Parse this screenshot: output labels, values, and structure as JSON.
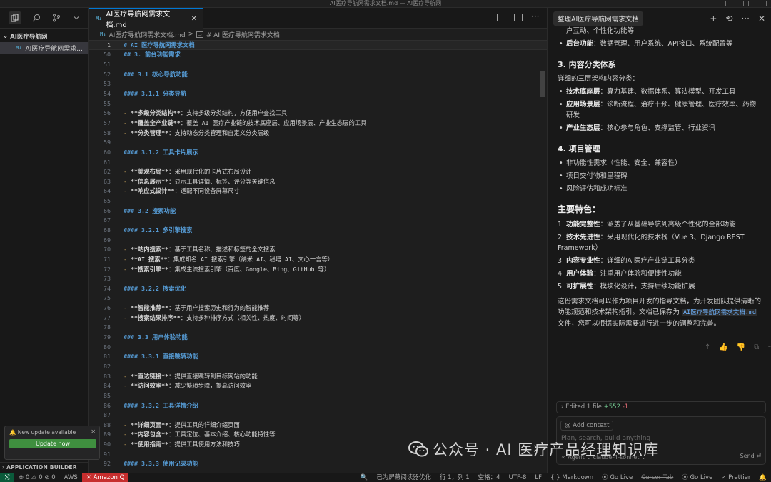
{
  "window": {
    "title": "AI医疗导航网需求文档.md — AI医疗导航网"
  },
  "sidebar": {
    "folder": "AI医疗导航网",
    "file": "AI医疗导航网需求...",
    "section": "APPLICATION BUILDER",
    "update": {
      "title": "New update available",
      "button": "Update now"
    }
  },
  "editor": {
    "tab": {
      "badge": "M↓",
      "label": "AI医疗导航网需求文档.md"
    },
    "breadcrumb": {
      "file": "AI医疗导航网需求文档.md",
      "sep": ">",
      "badge": "M↓",
      "heading": "# AI 医疗导航网需求文档"
    },
    "lines": [
      {
        "n": "1",
        "t": "h",
        "text": "# AI 医疗导航网需求文档",
        "current": true
      },
      {
        "n": "50",
        "t": "h",
        "text": "## 3. 前台功能需求"
      },
      {
        "n": "51",
        "t": "blank",
        "text": ""
      },
      {
        "n": "52",
        "t": "h",
        "text": "### 3.1 核心导航功能"
      },
      {
        "n": "53",
        "t": "blank",
        "text": ""
      },
      {
        "n": "54",
        "t": "h",
        "text": "#### 3.1.1 分类导航"
      },
      {
        "n": "55",
        "t": "blank",
        "text": ""
      },
      {
        "n": "56",
        "t": "li",
        "b": "**多级分类结构**",
        "text": "：支持多级分类结构，方便用户查找工具"
      },
      {
        "n": "57",
        "t": "li",
        "b": "**覆盖全产业链**",
        "text": "：覆盖 AI 医疗产业链的技术底座层、应用场景层、产业生态层的工具"
      },
      {
        "n": "58",
        "t": "li",
        "b": "**分类管理**",
        "text": "：支持动态分类管理和自定义分类层级"
      },
      {
        "n": "59",
        "t": "blank",
        "text": ""
      },
      {
        "n": "60",
        "t": "h",
        "text": "#### 3.1.2 工具卡片展示"
      },
      {
        "n": "61",
        "t": "blank",
        "text": ""
      },
      {
        "n": "62",
        "t": "li",
        "b": "**美观布局**",
        "text": "：采用现代化的卡片式布局设计"
      },
      {
        "n": "63",
        "t": "li",
        "b": "**信息展示**",
        "text": "：显示工具详情、标签、评分等关键信息"
      },
      {
        "n": "64",
        "t": "li",
        "b": "**响应式设计**",
        "text": "：适配不同设备屏幕尺寸"
      },
      {
        "n": "65",
        "t": "blank",
        "text": ""
      },
      {
        "n": "66",
        "t": "h",
        "text": "### 3.2 搜索功能"
      },
      {
        "n": "67",
        "t": "blank",
        "text": ""
      },
      {
        "n": "68",
        "t": "h",
        "text": "#### 3.2.1 多引擎搜索"
      },
      {
        "n": "69",
        "t": "blank",
        "text": ""
      },
      {
        "n": "70",
        "t": "li",
        "b": "**站内搜索**",
        "text": "：基于工具名称、描述和标签的全文搜索"
      },
      {
        "n": "71",
        "t": "li",
        "b": "**AI 搜索**",
        "text": "：集成知名 AI 搜索引擎（纳米 AI、秘塔 AI、文心一言等）"
      },
      {
        "n": "72",
        "t": "li",
        "b": "**搜索引擎**",
        "text": "：集成主流搜索引擎（百度、Google、Bing、GitHub 等）"
      },
      {
        "n": "73",
        "t": "blank",
        "text": ""
      },
      {
        "n": "74",
        "t": "h",
        "text": "#### 3.2.2 搜索优化"
      },
      {
        "n": "75",
        "t": "blank",
        "text": ""
      },
      {
        "n": "76",
        "t": "li",
        "b": "**智能推荐**",
        "text": "：基于用户搜索历史和行为的智能推荐"
      },
      {
        "n": "77",
        "t": "li",
        "b": "**搜索结果排序**",
        "text": "：支持多种排序方式（相关性、热度、时间等）"
      },
      {
        "n": "78",
        "t": "blank",
        "text": ""
      },
      {
        "n": "79",
        "t": "h",
        "text": "### 3.3 用户体验功能"
      },
      {
        "n": "80",
        "t": "blank",
        "text": ""
      },
      {
        "n": "81",
        "t": "h",
        "text": "#### 3.3.1 直接跳转功能"
      },
      {
        "n": "82",
        "t": "blank",
        "text": ""
      },
      {
        "n": "83",
        "t": "li",
        "b": "**直达链接**",
        "text": "：提供直接跳转到目标网站的功能"
      },
      {
        "n": "84",
        "t": "li",
        "b": "**访问效率**",
        "text": "：减少繁琐步骤，提高访问效率"
      },
      {
        "n": "85",
        "t": "blank",
        "text": ""
      },
      {
        "n": "86",
        "t": "h",
        "text": "#### 3.3.2 工具详情介绍"
      },
      {
        "n": "87",
        "t": "blank",
        "text": ""
      },
      {
        "n": "88",
        "t": "li",
        "b": "**详细页面**",
        "text": "：提供工具的详细介绍页面"
      },
      {
        "n": "89",
        "t": "li",
        "b": "**内容包含**",
        "text": "：工具定位、基本介绍、核心功能特性等"
      },
      {
        "n": "90",
        "t": "li",
        "b": "**使用指南**",
        "text": "：提供工具使用方法和技巧"
      },
      {
        "n": "91",
        "t": "blank",
        "text": ""
      },
      {
        "n": "92",
        "t": "h",
        "text": "#### 3.3.3 使用记录功能"
      }
    ]
  },
  "chat": {
    "tab": "整理AI医疗导航网需求文档",
    "frag": "户互动、个性化功能等",
    "backend": {
      "b": "后台功能",
      "text": "：数据管理、用户系统、API接口、系统配置等"
    },
    "sec3": "3. 内容分类体系",
    "sec3_intro": "详细的三层架构内容分类：",
    "sec3_items": [
      {
        "b": "技术底座层",
        "text": "：算力基建、数据体系、算法模型、开发工具"
      },
      {
        "b": "应用场景层",
        "text": "：诊断流程、治疗干预、健康管理、医疗效率、药物研发"
      },
      {
        "b": "产业生态层",
        "text": "：核心参与角色、支撑监管、行业资讯"
      }
    ],
    "sec4": "4. 项目管理",
    "sec4_items": [
      "非功能性需求（性能、安全、兼容性）",
      "项目交付物和里程碑",
      "风险评估和成功标准"
    ],
    "features_title": "主要特色：",
    "features": [
      {
        "n": "1.",
        "b": "功能完整性",
        "text": "：涵盖了从基础导航到高级个性化的全部功能"
      },
      {
        "n": "2.",
        "b": "技术先进性",
        "text": "：采用现代化的技术栈（Vue 3、Django REST Framework）"
      },
      {
        "n": "3.",
        "b": "内容专业性",
        "text": "：详细的AI医疗产业链工具分类"
      },
      {
        "n": "4.",
        "b": "用户体验",
        "text": "：注重用户体验和便捷性功能"
      },
      {
        "n": "5.",
        "b": "可扩展性",
        "text": "：模块化设计，支持后续功能扩展"
      }
    ],
    "summary_a": "这份需求文档可以作为项目开发的指导文档，为开发团队提供清晰的功能规范和技术架构指引。文档已保存为",
    "summary_code": "AI医疗导航网需求文档.md",
    "summary_b": "文件，您可以根据实际需要进行进一步的调整和完善。",
    "edited": {
      "label": "Edited 1 file",
      "plus": "+552",
      "minus": "-1"
    },
    "add_context": "Add context",
    "placeholder": "Plan, search, build anything",
    "agent": "∞ Agent ⌄   claude-4-sonnet ⌄",
    "send": "Send ⏎"
  },
  "watermark": "公众号 · AI 医疗产品经理知识库",
  "status": {
    "errors": "⊗ 0 ⚠ 0 ⊘ 0",
    "aws": "AWS",
    "amazon": "Amazon Q",
    "screenreader": "已为屏幕阅读器优化",
    "position": "行 1，列 1",
    "spaces": "空格：4",
    "encoding": "UTF-8",
    "eol": "LF",
    "lang": "Markdown",
    "golive1": "Go Live",
    "cursortab": "Cursor Tab",
    "golive2": "Go Live",
    "prettier": "✓ Prettier"
  }
}
